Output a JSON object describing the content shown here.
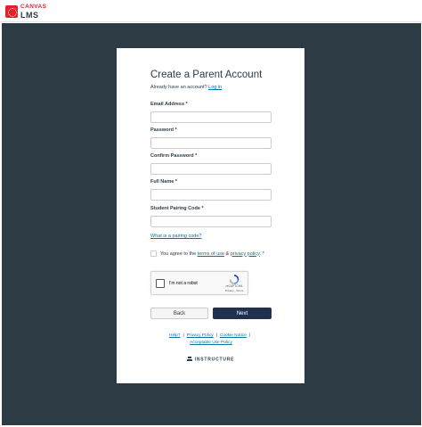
{
  "brand": {
    "top": "CANVAS",
    "bottom": "LMS",
    "accent": "#e4212b"
  },
  "form": {
    "title": "Create a Parent Account",
    "already_text": "Already have an account?",
    "login_link": "Log in",
    "fields": [
      {
        "label": "Email Address *",
        "value": "",
        "placeholder": ""
      },
      {
        "label": "Password *",
        "value": "",
        "placeholder": ""
      },
      {
        "label": "Confirm Password *",
        "value": "",
        "placeholder": ""
      },
      {
        "label": "Full Name *",
        "value": "",
        "placeholder": ""
      },
      {
        "label": "Student Pairing Code *",
        "value": "",
        "placeholder": ""
      }
    ],
    "pairing_link": "What is a pairing code?",
    "agree": {
      "prefix": "You agree to the",
      "terms": "terms of use",
      "and": "&",
      "privacy": "privacy policy",
      "suffix": ". *",
      "checked": false
    },
    "captcha": {
      "label": "I'm not a robot",
      "brand": "reCAPTCHA",
      "sub": "Privacy - Terms"
    },
    "back_button": "Back",
    "next_button": "Next",
    "next_color": "#1e3250"
  },
  "footer": {
    "help": "Help?",
    "privacy": "Privacy Policy",
    "cookie": "Cookie Notice",
    "aup": "Acceptable Use Policy",
    "separator": "|",
    "vendor": "INSTRUCTURE"
  },
  "colors": {
    "backdrop": "#2d3b45",
    "link": "#0770a3"
  }
}
